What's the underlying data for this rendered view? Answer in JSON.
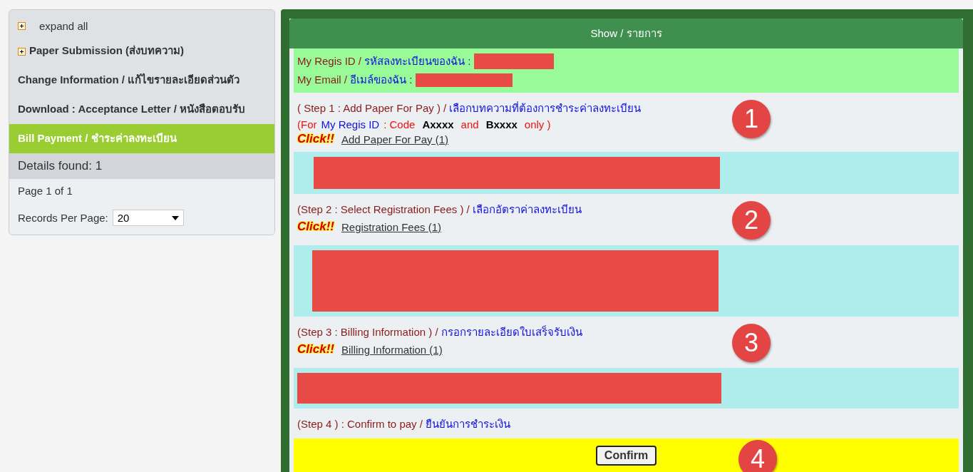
{
  "sidebar": {
    "expand_all": "expand all",
    "items": [
      {
        "label": "Paper Submission (ส่งบทความ)",
        "expandable": true,
        "selected": false
      },
      {
        "label": "Change Information / แก้ไขรายละเอียดส่วนตัว",
        "expandable": false,
        "selected": false
      },
      {
        "label": "Download : Acceptance Letter / หนังสือตอบรับ",
        "expandable": false,
        "selected": false
      },
      {
        "label": "Bill Payment / ชำระค่าลงทะเบียน",
        "expandable": false,
        "selected": true
      }
    ],
    "details_found": "Details found: 1",
    "page_info": "Page 1 of 1",
    "records_per_page": {
      "label": "Records Per Page:",
      "value": "20"
    }
  },
  "panel": {
    "title": "Show / รายการ",
    "info": [
      {
        "label_en": "My Regis ID / ",
        "label_th": "รหัสลงทะเบียนของฉัน :"
      },
      {
        "label_en": "My Email / ",
        "label_th": "อีเมล์ของฉัน :"
      }
    ],
    "steps": [
      {
        "title_en": "( Step 1 : Add Paper For Pay ) / ",
        "title_th": "เลือกบทความที่ต้องการชำระค่าลงทะเบียน",
        "number": "1",
        "note": [
          {
            "kind": "red",
            "text": "(For"
          },
          {
            "kind": "blue",
            "text": "My Regis ID"
          },
          {
            "kind": "red",
            "text": " : Code"
          },
          {
            "kind": "bold",
            "text": "Axxxx"
          },
          {
            "kind": "red",
            "text": "and"
          },
          {
            "kind": "bold",
            "text": "Bxxxx"
          },
          {
            "kind": "red",
            "text": "only )"
          }
        ],
        "badge": "Click!!",
        "link": "Add Paper For Pay (1)"
      },
      {
        "title_en": "(Step 2 : Select Registration Fees  ) / ",
        "title_th": "เลือกอัตราค่าลงทะเบียน",
        "number": "2",
        "badge": "Click!!",
        "link": "Registration Fees (1)"
      },
      {
        "title_en": "(Step 3 : Billing Information ) / ",
        "title_th": "กรอกรายละเอียดใบเสร็จรับเงิน",
        "number": "3",
        "badge": "Click!!",
        "link": "Billing Information (1)"
      }
    ],
    "confirm": {
      "title_en": "(Step 4 ) : Confirm to pay / ",
      "title_th": "ยืนยันการชำระเงิน",
      "button": "Confirm",
      "number": "4"
    }
  }
}
